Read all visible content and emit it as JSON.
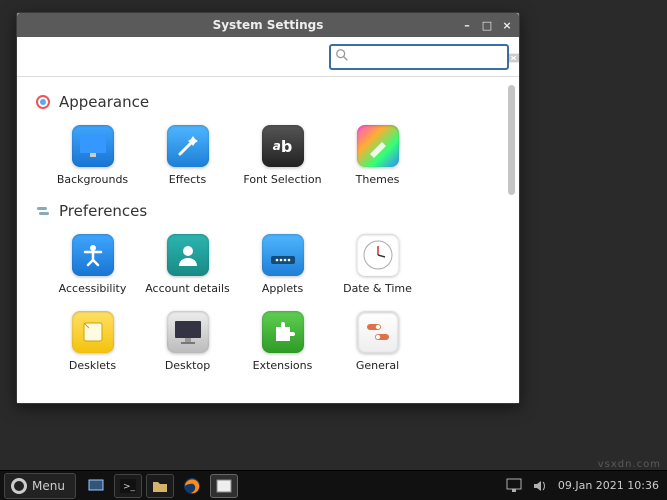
{
  "window": {
    "title": "System Settings",
    "minimize": "–",
    "maximize": "□",
    "close": "×"
  },
  "search": {
    "placeholder": "",
    "value": ""
  },
  "sections": {
    "appearance": {
      "title": "Appearance",
      "items": [
        {
          "label": "Backgrounds"
        },
        {
          "label": "Effects"
        },
        {
          "label": "Font Selection"
        },
        {
          "label": "Themes"
        }
      ]
    },
    "preferences": {
      "title": "Preferences",
      "items": [
        {
          "label": "Accessibility"
        },
        {
          "label": "Account details"
        },
        {
          "label": "Applets"
        },
        {
          "label": "Date & Time"
        },
        {
          "label": "Desklets"
        },
        {
          "label": "Desktop"
        },
        {
          "label": "Extensions"
        },
        {
          "label": "General"
        }
      ]
    }
  },
  "taskbar": {
    "menu_label": "Menu",
    "clock": "09.Jan 2021 10:36",
    "watermark": "vsxdn.com"
  }
}
